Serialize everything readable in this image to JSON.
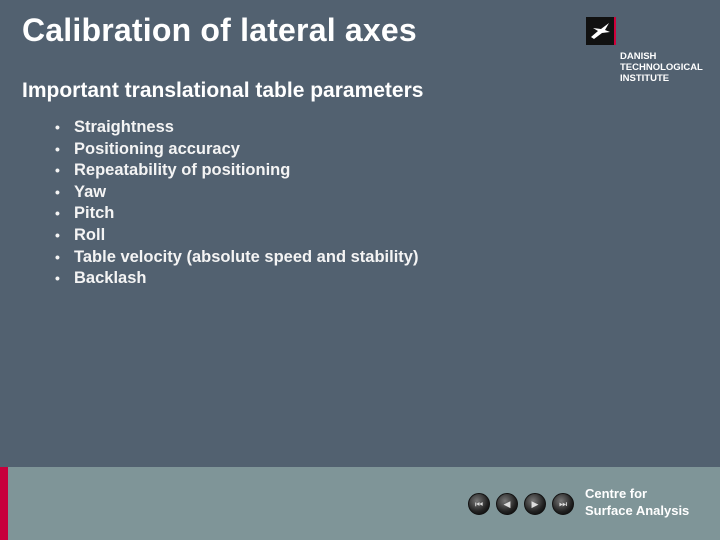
{
  "slide": {
    "title": "Calibration of lateral axes",
    "subtitle": "Important translational table parameters",
    "bullet_glyph": "•",
    "bullets": [
      "Straightness",
      "Positioning accuracy",
      "Repeatability of positioning",
      "Yaw",
      "Pitch",
      "Roll",
      "Table velocity (absolute speed and stability)",
      "Backlash"
    ]
  },
  "logo": {
    "line1": "DANISH",
    "line2": "TECHNOLOGICAL",
    "line3": "INSTITUTE"
  },
  "footer": {
    "nav": {
      "first_icon": "⏮",
      "prev_icon": "◀",
      "next_icon": "▶",
      "last_icon": "⏭"
    },
    "org_line1": "Centre for",
    "org_line2": "Surface Analysis"
  },
  "colors": {
    "background": "#526170",
    "footer": "#7f9598",
    "accent": "#c8003c"
  }
}
